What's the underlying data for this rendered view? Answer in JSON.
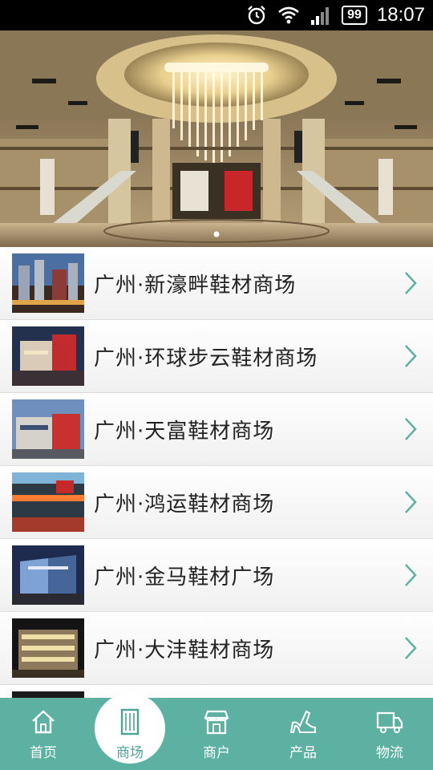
{
  "status_bar": {
    "battery": "99",
    "time": "18:07",
    "icons": [
      "alarm-icon",
      "wifi-icon",
      "signal-icon",
      "battery-icon"
    ]
  },
  "banner": {
    "image": "shopping-mall-atrium-chandelier",
    "indicator_count": 2,
    "active_indicator": 0
  },
  "malls": [
    {
      "title": "广州·新濠畔鞋材商场"
    },
    {
      "title": "广州·环球步云鞋材商场"
    },
    {
      "title": "广州·天富鞋材商场"
    },
    {
      "title": "广州·鸿运鞋材商场"
    },
    {
      "title": "广州·金马鞋材广场"
    },
    {
      "title": "广州·大沣鞋材商场"
    }
  ],
  "tabbar": {
    "tabs": [
      {
        "label": "首页",
        "icon": "house-icon"
      },
      {
        "label": "商场",
        "icon": "building-icon",
        "active": true
      },
      {
        "label": "商户",
        "icon": "storefront-icon"
      },
      {
        "label": "产品",
        "icon": "high-heel-icon"
      },
      {
        "label": "物流",
        "icon": "truck-icon"
      }
    ]
  },
  "colors": {
    "accent": "#5db1a2",
    "chevron": "#5db1a2"
  }
}
